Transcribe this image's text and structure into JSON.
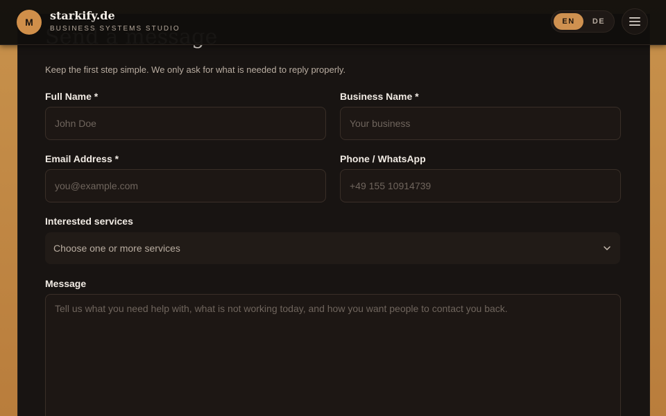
{
  "header": {
    "logo_letter": "M",
    "brand_name": "starkify.de",
    "brand_tagline": "BUSINESS SYSTEMS STUDIO",
    "languages": [
      "EN",
      "DE"
    ],
    "active_language": "EN",
    "menu_icon": "hamburger-menu-icon"
  },
  "form": {
    "title": "Send a message",
    "subtitle": "Keep the first step simple. We only ask for what is needed to reply properly.",
    "full_name": {
      "label": "Full Name *",
      "placeholder": "John Doe",
      "value": ""
    },
    "business_name": {
      "label": "Business Name *",
      "placeholder": "Your business",
      "value": ""
    },
    "email": {
      "label": "Email Address *",
      "placeholder": "you@example.com",
      "value": ""
    },
    "phone": {
      "label": "Phone / WhatsApp",
      "placeholder": "+49 155 10914739",
      "value": ""
    },
    "services": {
      "label": "Interested services",
      "placeholder": "Choose one or more services",
      "icon": "chevron-down-icon"
    },
    "message": {
      "label": "Message",
      "placeholder": "Tell us what you need help with, what is not working today, and how you want people to contact you back.",
      "value": ""
    }
  },
  "colors": {
    "accent": "#cf9150",
    "background": "#181412",
    "page_frame": "#c8924c"
  }
}
